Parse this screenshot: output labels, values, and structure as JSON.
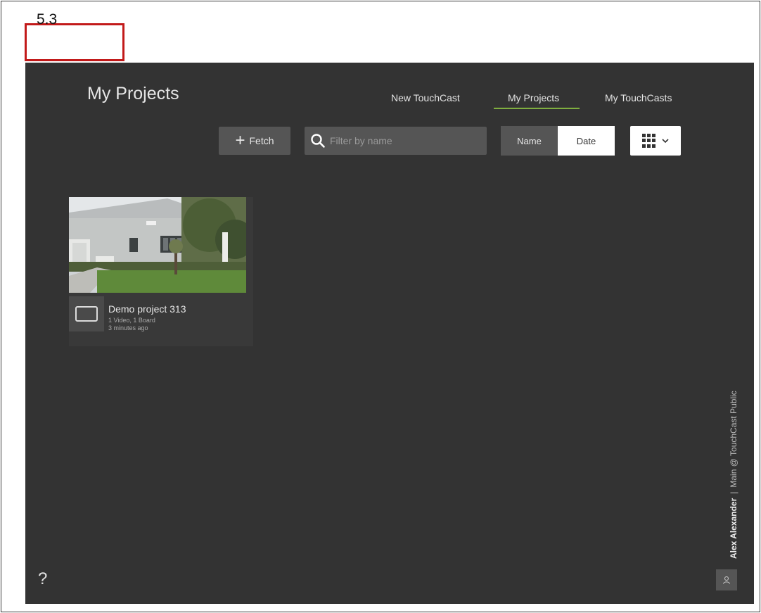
{
  "step_label": "5.3",
  "header": {
    "title": "My Projects",
    "tabs": [
      {
        "label": "New TouchCast"
      },
      {
        "label": "My Projects"
      },
      {
        "label": "My TouchCasts"
      }
    ]
  },
  "toolbar": {
    "fetch_label": "Fetch",
    "search_placeholder": "Filter by name",
    "sort_name_label": "Name",
    "sort_date_label": "Date"
  },
  "projects": [
    {
      "title": "Demo project 313",
      "summary": "1 Video, 1 Board",
      "updated": "3 minutes ago"
    }
  ],
  "account": {
    "user": "Alex Alexander",
    "separator": "|",
    "workspace": "Main @ TouchCast Public"
  },
  "help_label": "?",
  "colors": {
    "background": "#333333",
    "accent": "#7fae3f",
    "step_border": "#c21a1a"
  }
}
